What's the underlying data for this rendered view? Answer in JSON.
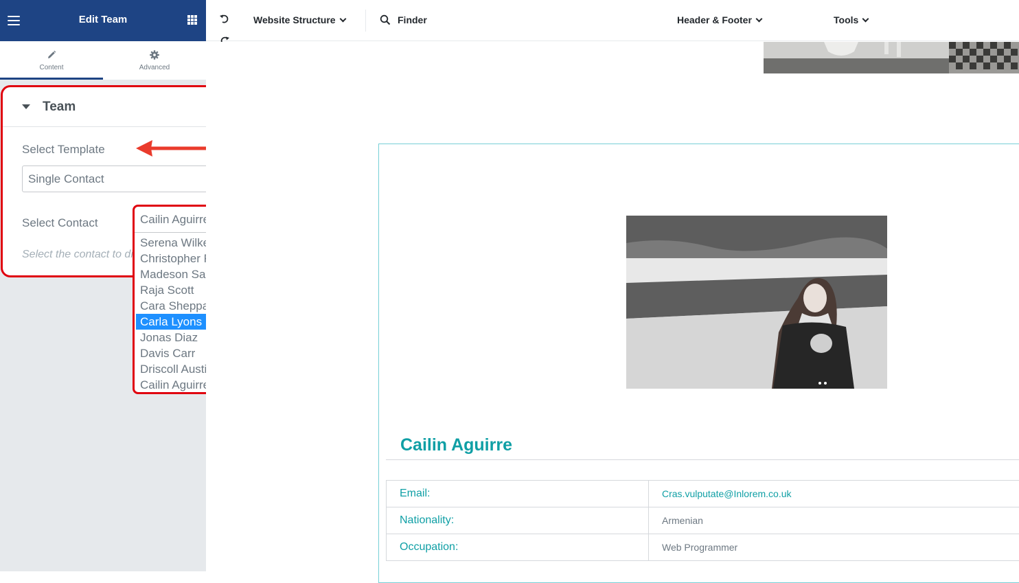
{
  "panel": {
    "title": "Edit Team",
    "tabs": [
      {
        "label": "Content",
        "icon": "pencil-icon"
      },
      {
        "label": "Advanced",
        "icon": "gear-icon"
      }
    ]
  },
  "team_section": {
    "title": "Team",
    "select_template_label": "Select Template",
    "template_value": "Single Contact",
    "select_contact_label": "Select Contact",
    "contact_value": "Cailin Aguirre",
    "help_text": "Select the contact to display",
    "contact_options": [
      "Serena Wilkerson",
      "Christopher Roy",
      "Madeson Santiago",
      "Raja Scott",
      "Cara Sheppard",
      "Carla Lyons",
      "Jonas Diaz",
      "Davis Carr",
      "Driscoll Austin",
      "Cailin Aguirre"
    ],
    "highlighted_option": "Carla Lyons"
  },
  "topbar": {
    "website_structure": "Website Structure",
    "finder": "Finder",
    "header_footer": "Header & Footer",
    "tools": "Tools"
  },
  "preview": {
    "contact_name": "Cailin Aguirre",
    "fields": [
      {
        "label": "Email:",
        "value": "Cras.vulputate@Inlorem.co.uk"
      },
      {
        "label": "Nationality:",
        "value": "Armenian"
      },
      {
        "label": "Occupation:",
        "value": "Web Programmer"
      }
    ]
  },
  "colors": {
    "panel_header": "#1e4484",
    "highlight_border": "#e0000e",
    "accent_teal": "#0f9fa5",
    "selected_option": "#1e90ff",
    "annotation_arrow": "#ea3b2c"
  }
}
